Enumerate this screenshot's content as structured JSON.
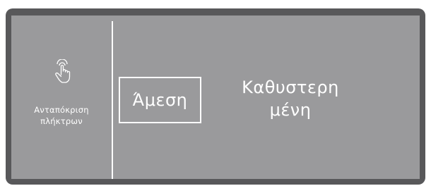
{
  "side_panel": {
    "icon": "touch-hand-icon",
    "label_line1": "Ανταπόκριση",
    "label_line2": "πλήκτρων"
  },
  "options": {
    "immediate_label": "Άμεση",
    "delayed_label_line1": "Καθυστερη",
    "delayed_label_line2": "μένη",
    "selected": "immediate"
  },
  "colors": {
    "bezel": "#58585a",
    "display_background": "#9a9a9c",
    "text": "#ffffff"
  }
}
